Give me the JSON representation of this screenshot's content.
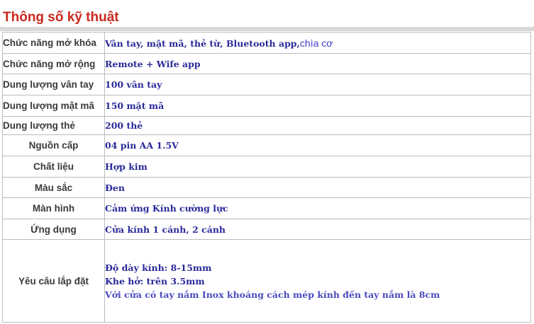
{
  "title": "Thông số kỹ thuật",
  "rows": [
    {
      "label": "Chức năng mở khóa",
      "value": "Vân tay, mật mã, thẻ từ, Bluetooth app,",
      "value_extra": "chìa cơ"
    },
    {
      "label": "Chức năng mở rộng",
      "value": "Remote + Wife app"
    },
    {
      "label": "Dung lượng vân tay",
      "value": "100 vân tay"
    },
    {
      "label": "Dung lượng mật mã",
      "value": "150 mật mã"
    },
    {
      "label": "Dung lượng thẻ",
      "value": "200 thẻ"
    },
    {
      "label": "Nguồn cấp",
      "value": "04 pin AA 1.5V"
    },
    {
      "label": "Chất liệu",
      "value": "Hợp kim"
    },
    {
      "label": "Màu sắc",
      "value": "Đen"
    },
    {
      "label": "Màn hình",
      "value": "Cảm ứng Kính cường lực"
    },
    {
      "label": "Ứng dụng",
      "value": "Cửa kính 1 cánh, 2 cánh"
    }
  ],
  "install": {
    "label": "Yêu câu lắp đặt",
    "lines": [
      "Độ dày kính: 8-15mm",
      "Khe hở: trên 3.5mm",
      "Với cửa có tay nắm Inox khoáng cách mép kính đến tay nắm là 8cm"
    ]
  },
  "colors": {
    "title": "#c8281e",
    "value_text": "#2a2a9a",
    "label_text": "#3a3a3a",
    "border": "#bcbcbc"
  }
}
